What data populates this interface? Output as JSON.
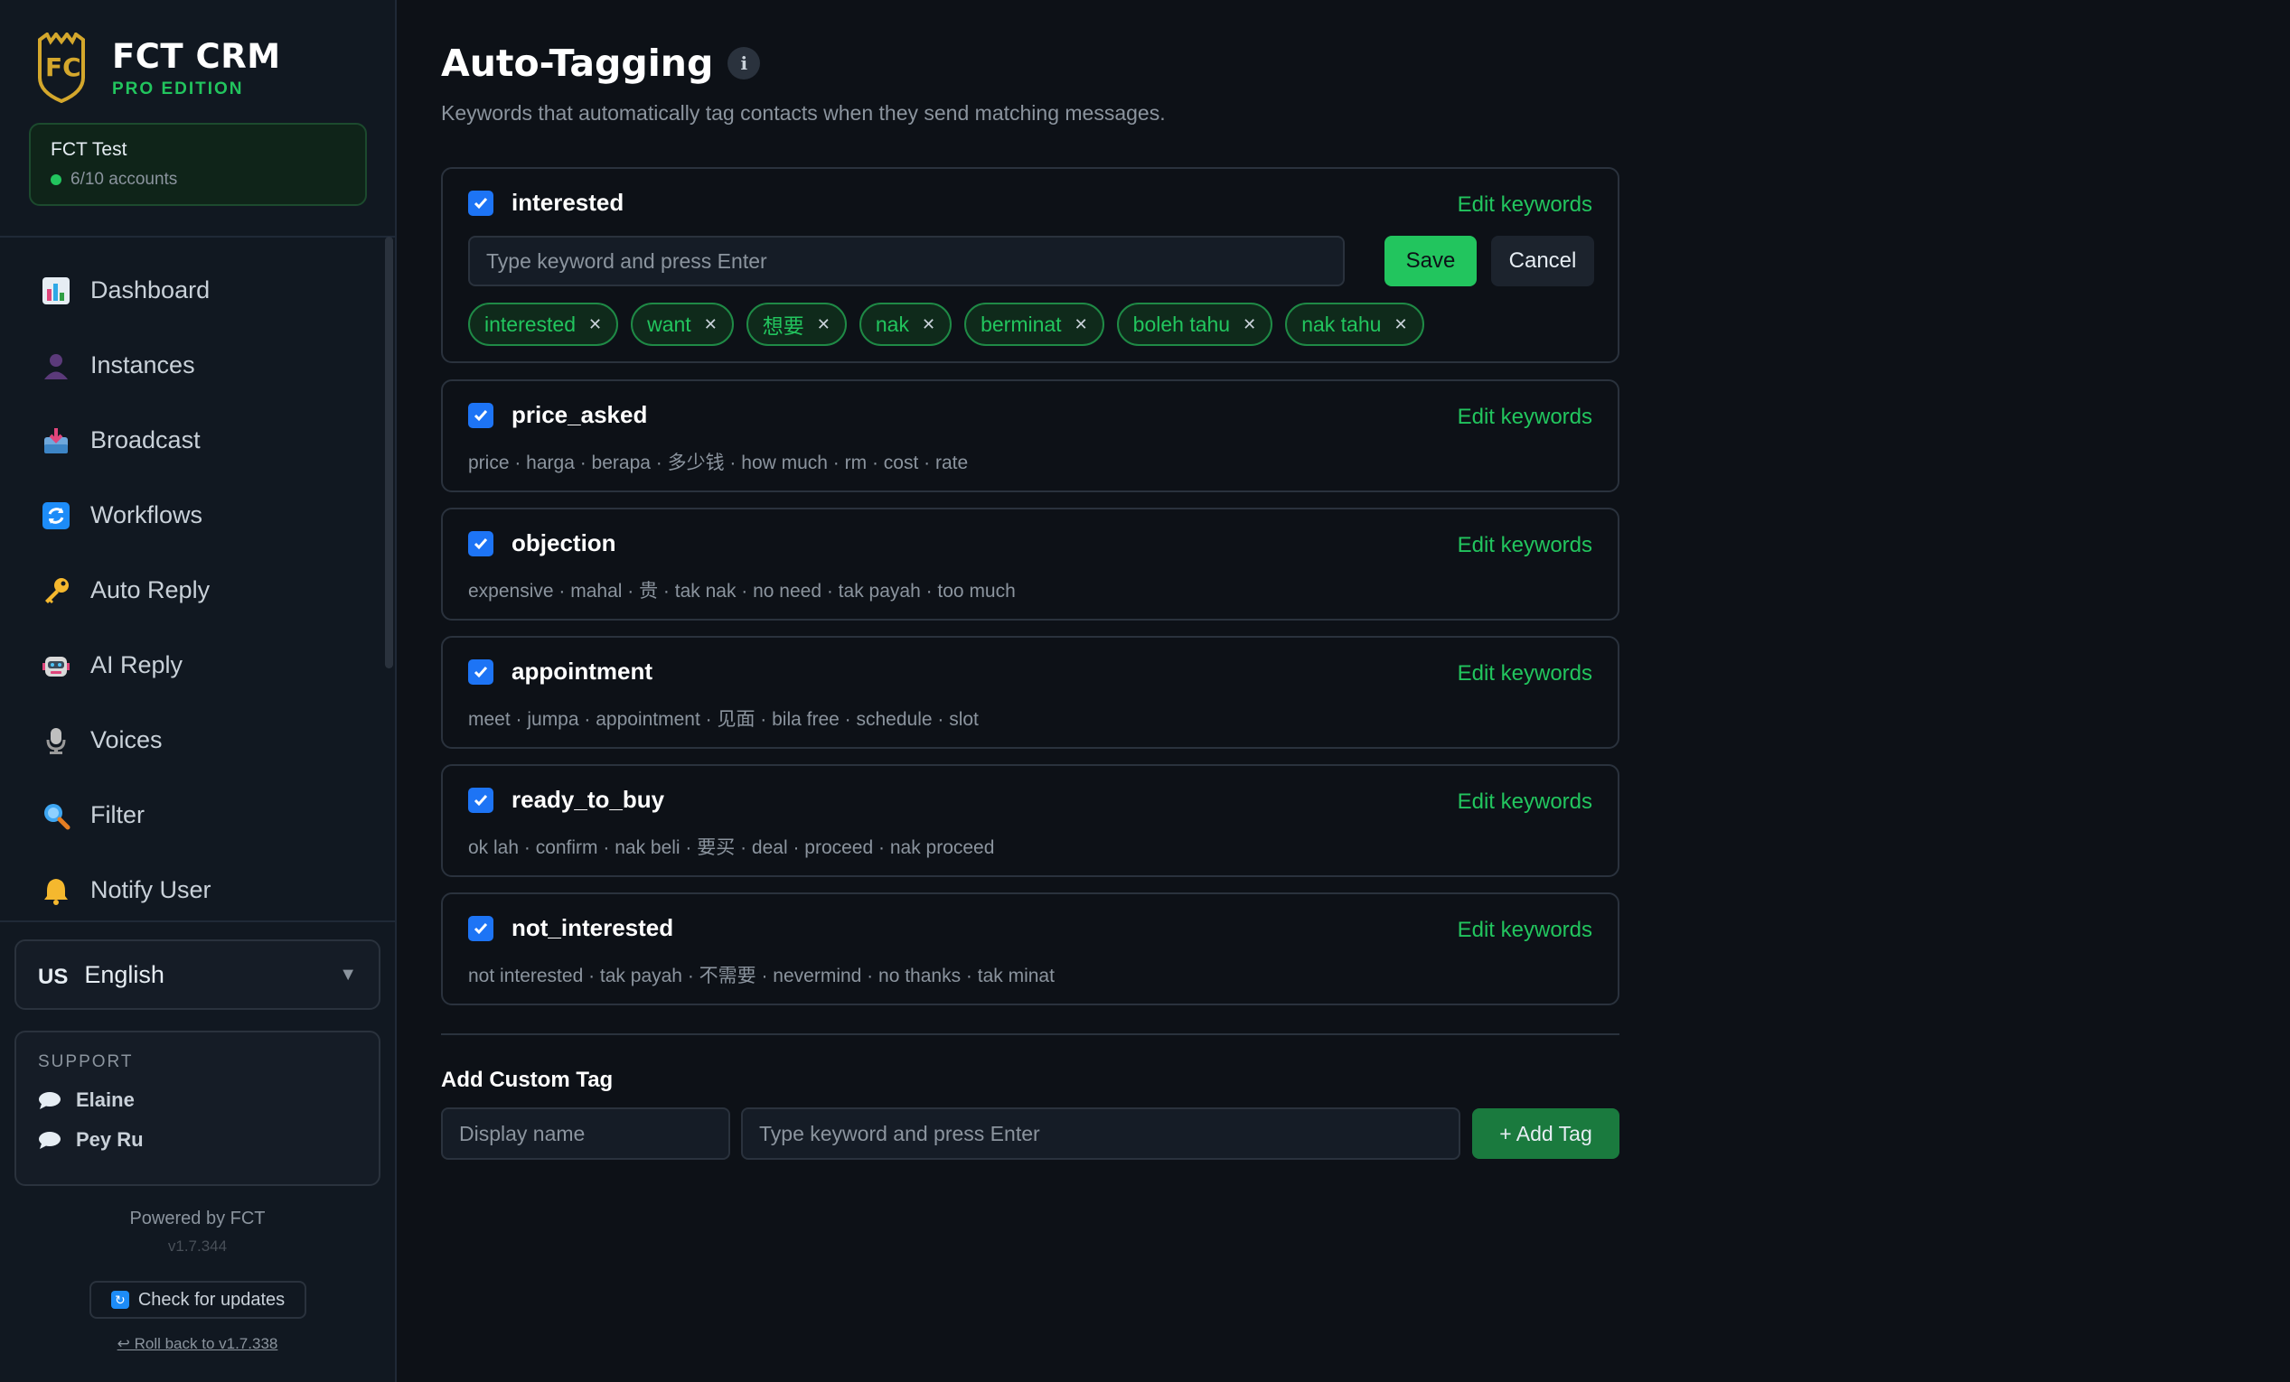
{
  "brand": {
    "title": "FCT CRM",
    "subtitle": "PRO EDITION"
  },
  "account": {
    "name": "FCT Test",
    "status": "6/10 accounts"
  },
  "nav": [
    {
      "label": "Dashboard",
      "icon": "bar-chart-icon"
    },
    {
      "label": "Instances",
      "icon": "person-icon"
    },
    {
      "label": "Broadcast",
      "icon": "inbox-icon"
    },
    {
      "label": "Workflows",
      "icon": "refresh-icon"
    },
    {
      "label": "Auto Reply",
      "icon": "key-icon"
    },
    {
      "label": "AI Reply",
      "icon": "robot-icon"
    },
    {
      "label": "Voices",
      "icon": "microphone-icon"
    },
    {
      "label": "Filter",
      "icon": "magnifier-icon"
    },
    {
      "label": "Notify User",
      "icon": "bell-icon"
    }
  ],
  "language": {
    "flag": "US",
    "selected": "English"
  },
  "support": {
    "title": "SUPPORT",
    "contacts": [
      "Elaine",
      "Pey Ru"
    ]
  },
  "footer": {
    "powered": "Powered by FCT",
    "version": "v1.7.344",
    "update_label": "Check for updates",
    "rollback_label": "↩ Roll back to v1.7.338"
  },
  "page": {
    "title": "Auto-Tagging",
    "description": "Keywords that automatically tag contacts when they send matching messages."
  },
  "edit_label": "Edit keywords",
  "editor": {
    "placeholder": "Type keyword and press Enter",
    "save_label": "Save",
    "cancel_label": "Cancel"
  },
  "tags": [
    {
      "name": "interested",
      "checked": true,
      "editing": true,
      "keywords": [
        "interested",
        "want",
        "想要",
        "nak",
        "berminat",
        "boleh tahu",
        "nak tahu"
      ]
    },
    {
      "name": "price_asked",
      "checked": true,
      "keywords_text": "price · harga · berapa · 多少钱 · how much · rm · cost · rate"
    },
    {
      "name": "objection",
      "checked": true,
      "keywords_text": "expensive · mahal · 贵 · tak nak · no need · tak payah · too much"
    },
    {
      "name": "appointment",
      "checked": true,
      "keywords_text": "meet · jumpa · appointment · 见面 · bila free · schedule · slot"
    },
    {
      "name": "ready_to_buy",
      "checked": true,
      "keywords_text": "ok lah · confirm · nak beli · 要买 · deal · proceed · nak proceed"
    },
    {
      "name": "not_interested",
      "checked": true,
      "keywords_text": "not interested · tak payah · 不需要 · nevermind · no thanks · tak minat"
    }
  ],
  "custom": {
    "title": "Add Custom Tag",
    "name_placeholder": "Display name",
    "keyword_placeholder": "Type keyword and press Enter",
    "add_label": "+ Add Tag"
  },
  "colors": {
    "accent": "#22c55e",
    "checkbox": "#1d74f5",
    "background": "#0d1117"
  }
}
